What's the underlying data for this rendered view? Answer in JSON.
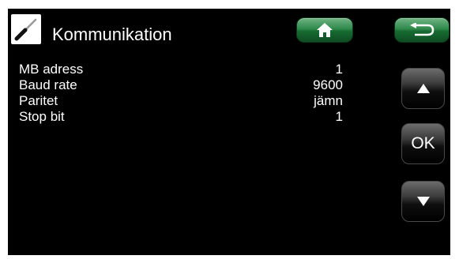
{
  "header": {
    "title": "Kommunikation",
    "tool_icon": "screwdriver-icon",
    "home_icon": "home-icon",
    "back_icon": "back-arrow-icon"
  },
  "settings": [
    {
      "label": "MB adress",
      "value": "1"
    },
    {
      "label": "Baud rate",
      "value": "9600"
    },
    {
      "label": "Paritet",
      "value": "jämn"
    },
    {
      "label": "Stop bit",
      "value": "1"
    }
  ],
  "nav": {
    "up_icon": "triangle-up-icon",
    "ok_label": "OK",
    "down_icon": "triangle-down-icon"
  },
  "colors": {
    "background": "#000000",
    "text": "#ffffff",
    "header_button": "#2f8a4b",
    "nav_button": "#3a3a3a"
  }
}
